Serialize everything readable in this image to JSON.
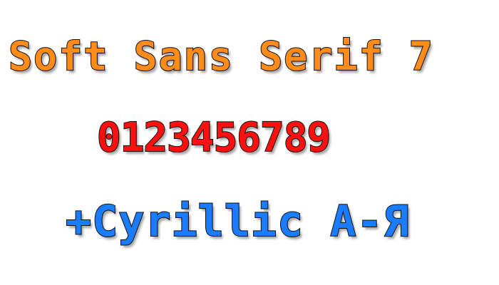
{
  "sample": {
    "lines": [
      {
        "text": "Soft Sans Serif 7",
        "color": "#ff8c1a"
      },
      {
        "text": "0123456789",
        "color": "#ff1010"
      },
      {
        "text": "+Cyrillic A-Я",
        "color": "#1a7dff"
      }
    ]
  }
}
